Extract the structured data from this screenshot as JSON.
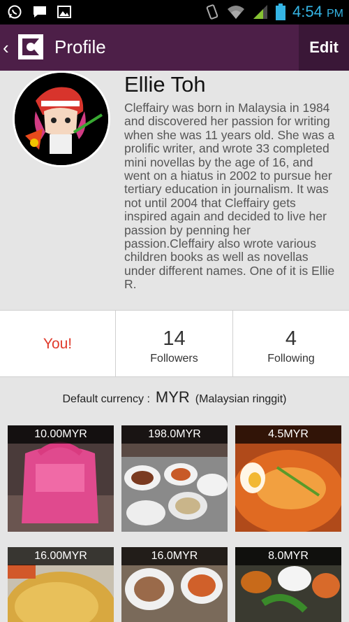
{
  "status_bar": {
    "time": "4:54",
    "ampm": "PM"
  },
  "action_bar": {
    "back_glyph": "‹",
    "title": "Profile",
    "edit_label": "Edit"
  },
  "profile": {
    "name": "Ellie Toh",
    "bio": "Cleffairy was born in Malaysia in 1984 and discovered her passion for writing when she was 11 years old. She was a prolific writer, and wrote 33 completed mini novellas by the age of 16, and went on a hiatus in 2002 to pursue her tertiary education in journalism. It was not until 2004 that Cleffairy gets inspired again and decided to live her passion by penning her passion.Cleffairy also wrote various children books as well as novellas under different names. One of it is Ellie R."
  },
  "stats": {
    "you_label": "You!",
    "followers_count": "14",
    "followers_label": "Followers",
    "following_count": "4",
    "following_label": "Following"
  },
  "currency": {
    "label": "Default currency :",
    "code": "MYR",
    "name": "(Malaysian ringgit)"
  },
  "items": [
    {
      "price": "10.00MYR"
    },
    {
      "price": "198.0MYR"
    },
    {
      "price": "4.5MYR"
    },
    {
      "price": "16.00MYR"
    },
    {
      "price": "16.0MYR"
    },
    {
      "price": "8.0MYR"
    }
  ],
  "colors": {
    "action_bar": "#4d1f48",
    "edit_bg": "#3a1737",
    "you_red": "#e03a2b",
    "clock_blue": "#35b5e5"
  }
}
